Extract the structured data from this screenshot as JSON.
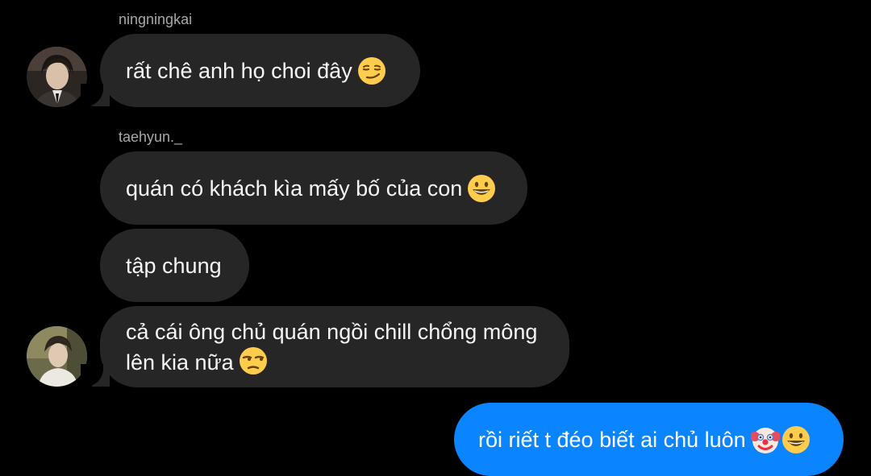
{
  "conversation": {
    "groups": [
      {
        "sender": "ningningkai",
        "messages": [
          {
            "text": "rất chê anh họ choi đây",
            "emojis": [
              "smirk-emoji"
            ]
          }
        ]
      },
      {
        "sender": "taehyun._",
        "messages": [
          {
            "text": "quán có khách kìa mấy bố của con",
            "emojis": [
              "grinning-emoji"
            ]
          },
          {
            "text": "tập chung",
            "emojis": []
          },
          {
            "line1": "cả cái ông chủ quán ngồi chill chổng mông",
            "line2": "lên kia nữa",
            "emojis": [
              "unamused-emoji"
            ]
          }
        ]
      }
    ],
    "outgoing": [
      {
        "text": "rồi riết t đéo biết ai chủ luôn",
        "emojis": [
          "clown-emoji",
          "grinning-emoji"
        ]
      }
    ]
  },
  "colors": {
    "background": "#000000",
    "incoming_bubble": "#262626",
    "outgoing_bubble": "#0a84ff",
    "sender_name": "#a8a8a8"
  }
}
